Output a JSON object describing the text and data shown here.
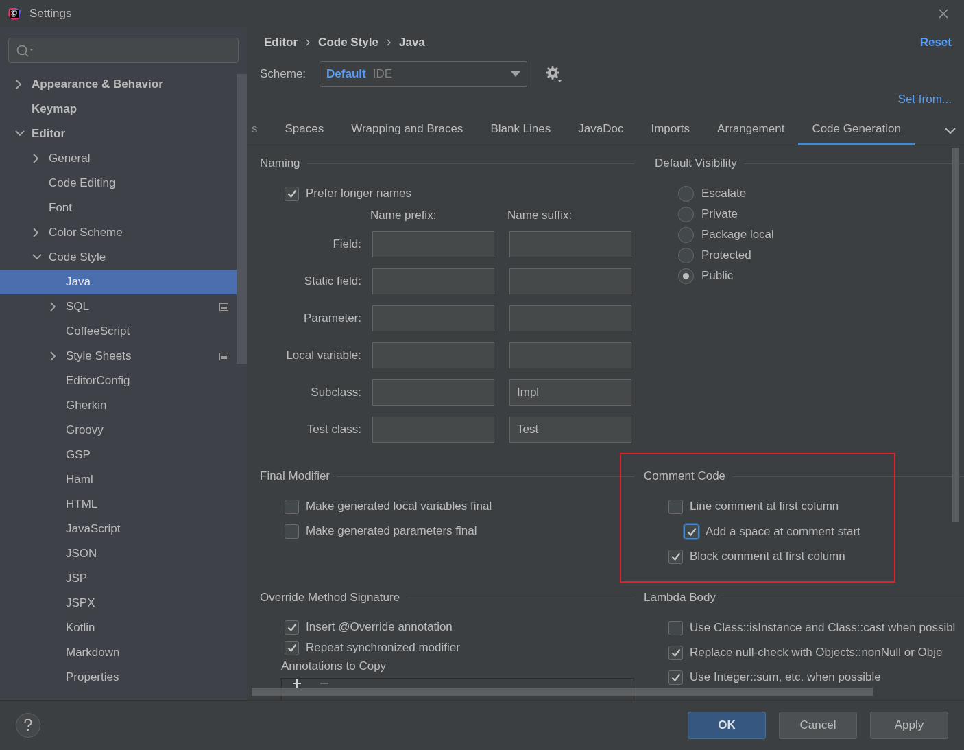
{
  "window": {
    "title": "Settings"
  },
  "sidebar": {
    "tree": [
      {
        "label": "Appearance & Behavior",
        "kind": "folder",
        "expanded": false,
        "selected": false,
        "project_icon": false
      },
      {
        "label": "Keymap",
        "kind": "leaf",
        "selected": false,
        "project_icon": false
      },
      {
        "label": "Editor",
        "kind": "folder",
        "expanded": true,
        "selected": false,
        "project_icon": false,
        "children": [
          {
            "label": "General",
            "kind": "folder",
            "expanded": false,
            "selected": false,
            "project_icon": false
          },
          {
            "label": "Code Editing",
            "kind": "leaf",
            "selected": false,
            "project_icon": false
          },
          {
            "label": "Font",
            "kind": "leaf",
            "selected": false,
            "project_icon": false
          },
          {
            "label": "Color Scheme",
            "kind": "folder",
            "expanded": false,
            "selected": false,
            "project_icon": false
          },
          {
            "label": "Code Style",
            "kind": "folder",
            "expanded": true,
            "selected": false,
            "project_icon": false,
            "children": [
              {
                "label": "Java",
                "kind": "leaf",
                "selected": true,
                "project_icon": false
              },
              {
                "label": "SQL",
                "kind": "folder",
                "expanded": false,
                "selected": false,
                "project_icon": true
              },
              {
                "label": "CoffeeScript",
                "kind": "leaf",
                "selected": false,
                "project_icon": false
              },
              {
                "label": "Style Sheets",
                "kind": "folder",
                "expanded": false,
                "selected": false,
                "project_icon": true
              },
              {
                "label": "EditorConfig",
                "kind": "leaf",
                "selected": false,
                "project_icon": false
              },
              {
                "label": "Gherkin",
                "kind": "leaf",
                "selected": false,
                "project_icon": false
              },
              {
                "label": "Groovy",
                "kind": "leaf",
                "selected": false,
                "project_icon": false
              },
              {
                "label": "GSP",
                "kind": "leaf",
                "selected": false,
                "project_icon": false
              },
              {
                "label": "Haml",
                "kind": "leaf",
                "selected": false,
                "project_icon": false
              },
              {
                "label": "HTML",
                "kind": "leaf",
                "selected": false,
                "project_icon": false
              },
              {
                "label": "JavaScript",
                "kind": "leaf",
                "selected": false,
                "project_icon": false
              },
              {
                "label": "JSON",
                "kind": "leaf",
                "selected": false,
                "project_icon": false
              },
              {
                "label": "JSP",
                "kind": "leaf",
                "selected": false,
                "project_icon": false
              },
              {
                "label": "JSPX",
                "kind": "leaf",
                "selected": false,
                "project_icon": false
              },
              {
                "label": "Kotlin",
                "kind": "leaf",
                "selected": false,
                "project_icon": false
              },
              {
                "label": "Markdown",
                "kind": "leaf",
                "selected": false,
                "project_icon": false
              },
              {
                "label": "Properties",
                "kind": "leaf",
                "selected": false,
                "project_icon": false
              }
            ]
          }
        ]
      }
    ]
  },
  "breadcrumb": [
    "Editor",
    "Code Style",
    "Java"
  ],
  "reset_link": "Reset",
  "scheme": {
    "label": "Scheme:",
    "value": "Default",
    "qualifier": "IDE"
  },
  "set_from_link": "Set from...",
  "tabs": [
    {
      "label": "s",
      "selected": false
    },
    {
      "label": "Spaces",
      "selected": false
    },
    {
      "label": "Wrapping and Braces",
      "selected": false
    },
    {
      "label": "Blank Lines",
      "selected": false
    },
    {
      "label": "JavaDoc",
      "selected": false
    },
    {
      "label": "Imports",
      "selected": false
    },
    {
      "label": "Arrangement",
      "selected": false
    },
    {
      "label": "Code Generation",
      "selected": true
    }
  ],
  "naming": {
    "title": "Naming",
    "prefer_longer": {
      "label": "Prefer longer names",
      "checked": true
    },
    "prefix_heading": "Name prefix:",
    "suffix_heading": "Name suffix:",
    "rows": [
      {
        "label": "Field:"
      },
      {
        "label": "Static field:"
      },
      {
        "label": "Parameter:"
      },
      {
        "label": "Local variable:"
      },
      {
        "label": "Subclass:",
        "suffix": "Impl"
      },
      {
        "label": "Test class:",
        "suffix": "Test"
      }
    ]
  },
  "default_visibility": {
    "title": "Default Visibility",
    "options": [
      {
        "label": "Escalate",
        "selected": false
      },
      {
        "label": "Private",
        "selected": false
      },
      {
        "label": "Package local",
        "selected": false
      },
      {
        "label": "Protected",
        "selected": false
      },
      {
        "label": "Public",
        "selected": true
      }
    ]
  },
  "final_modifier": {
    "title": "Final Modifier",
    "options": [
      {
        "label": "Make generated local variables final",
        "checked": false
      },
      {
        "label": "Make generated parameters final",
        "checked": false
      }
    ]
  },
  "comment_code": {
    "title": "Comment Code",
    "highlighted": true,
    "options": [
      {
        "label": "Line comment at first column",
        "checked": false,
        "focused": false,
        "children": [
          {
            "label": "Add a space at comment start",
            "checked": true,
            "focused": true
          }
        ]
      },
      {
        "label": "Block comment at first column",
        "checked": true,
        "focused": false
      }
    ]
  },
  "override_method_signature": {
    "title": "Override Method Signature",
    "options": [
      {
        "label": "Insert @Override annotation",
        "checked": true
      },
      {
        "label": "Repeat synchronized modifier",
        "checked": true
      }
    ],
    "annotations_label": "Annotations to Copy"
  },
  "lambda_body": {
    "title": "Lambda Body",
    "options": [
      {
        "label": "Use Class::isInstance and Class::cast when possibl",
        "checked": false
      },
      {
        "label": "Replace null-check with Objects::nonNull or Obje",
        "checked": true
      },
      {
        "label": "Use Integer::sum, etc. when possible",
        "checked": true
      }
    ]
  },
  "buttons": [
    {
      "label": "OK",
      "kind": "primary"
    },
    {
      "label": "Cancel",
      "kind": "normal"
    },
    {
      "label": "Apply",
      "kind": "normal"
    }
  ]
}
